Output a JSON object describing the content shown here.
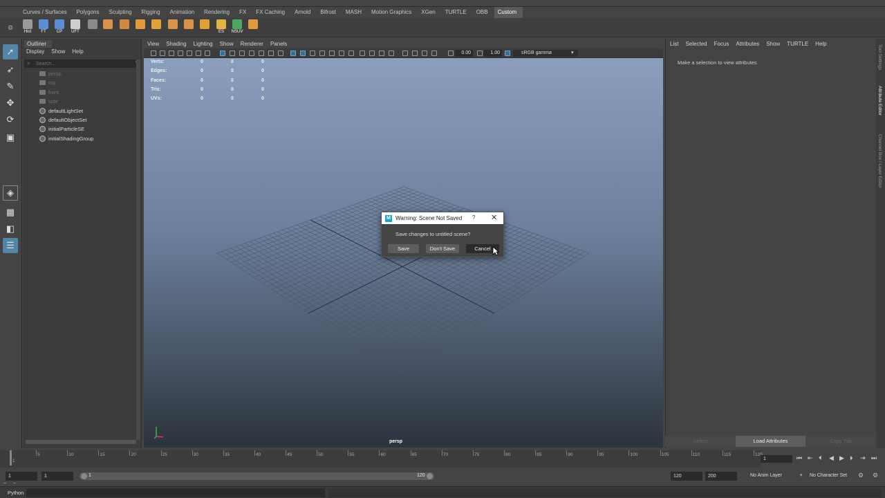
{
  "shelf_tabs": [
    "Curves / Surfaces",
    "Polygons",
    "Sculpting",
    "Rigging",
    "Animation",
    "Rendering",
    "FX",
    "FX Caching",
    "Arnold",
    "Bifrost",
    "MASH",
    "Motion Graphics",
    "XGen",
    "TURTLE",
    "OBB",
    "Custom"
  ],
  "shelf_active_tab": "Custom",
  "shelf_buttons": [
    {
      "label": "Hist",
      "icon": "history-icon",
      "color": "#9a9a9a"
    },
    {
      "label": "FT",
      "icon": "freeze-transform-icon",
      "color": "#5b8ed6"
    },
    {
      "label": "CP",
      "icon": "center-pivot-icon",
      "color": "#5b8ed6"
    },
    {
      "label": "UFT",
      "icon": "unfreeze-transform-icon",
      "color": "#cfcfcf"
    },
    {
      "label": "",
      "icon": "snap-grid-icon",
      "color": "#8a8a8a"
    },
    {
      "label": "",
      "icon": "cube-icon",
      "color": "#d9924a"
    },
    {
      "label": "",
      "icon": "scatter-icon",
      "color": "#d08a40"
    },
    {
      "label": "",
      "icon": "arrow-tool-icon",
      "color": "#e39a3c"
    },
    {
      "label": "",
      "icon": "pencil-icon",
      "color": "#e3a13c"
    },
    {
      "label": "",
      "icon": "brush-icon",
      "color": "#d9924a"
    },
    {
      "label": "",
      "icon": "box-icon",
      "color": "#d9924a"
    },
    {
      "label": "",
      "icon": "diamond-icon",
      "color": "#e0a030"
    },
    {
      "label": "ES",
      "icon": "folder-icon",
      "color": "#e0b440"
    },
    {
      "label": "NSUV",
      "icon": "uv-icon",
      "color": "#4ea860"
    },
    {
      "label": "",
      "icon": "sphere-cube-icon",
      "color": "#e09a40"
    }
  ],
  "outliner": {
    "tab_label": "Outliner",
    "menu": [
      "Display",
      "Show",
      "Help"
    ],
    "search_placeholder": "Search...",
    "items": [
      {
        "label": "persp",
        "dim": true,
        "icon": "camera-icon"
      },
      {
        "label": "top",
        "dim": true,
        "icon": "camera-icon"
      },
      {
        "label": "front",
        "dim": true,
        "icon": "camera-icon"
      },
      {
        "label": "side",
        "dim": true,
        "icon": "camera-icon"
      },
      {
        "label": "defaultLightSet",
        "dim": false,
        "icon": "set-icon"
      },
      {
        "label": "defaultObjectSet",
        "dim": false,
        "icon": "set-icon"
      },
      {
        "label": "initialParticleSE",
        "dim": false,
        "icon": "set-icon"
      },
      {
        "label": "initialShadingGroup",
        "dim": false,
        "icon": "set-icon"
      }
    ]
  },
  "viewport": {
    "menu": [
      "View",
      "Shading",
      "Lighting",
      "Show",
      "Renderer",
      "Panels"
    ],
    "exposure": "0.00",
    "gamma": "1.00",
    "color_space": "sRGB gamma",
    "camera_label": "persp",
    "hud": [
      {
        "label": "Verts:",
        "values": [
          "0",
          "0",
          "0"
        ]
      },
      {
        "label": "Edges:",
        "values": [
          "0",
          "0",
          "0"
        ]
      },
      {
        "label": "Faces:",
        "values": [
          "0",
          "0",
          "0"
        ]
      },
      {
        "label": "Tris:",
        "values": [
          "0",
          "0",
          "0"
        ]
      },
      {
        "label": "UVs:",
        "values": [
          "0",
          "0",
          "0"
        ]
      }
    ]
  },
  "dialog": {
    "title": "Warning: Scene Not Saved",
    "help": "?",
    "close": "✕",
    "message": "Save changes to untitled scene?",
    "buttons": {
      "save": "Save",
      "dont_save": "Don't Save",
      "cancel": "Cancel"
    }
  },
  "attribute_editor": {
    "menu": [
      "List",
      "Selected",
      "Focus",
      "Attributes",
      "Show",
      "TURTLE",
      "Help"
    ],
    "message": "Make a selection to view attributes",
    "buttons": {
      "select": "Select",
      "load": "Load Attributes",
      "copy": "Copy Tab"
    },
    "side_tabs": [
      "Tool Settings",
      "Attribute Editor",
      "Channel Box / Layer Editor"
    ]
  },
  "timeline": {
    "ticks": [
      "1",
      "5",
      "10",
      "15",
      "20",
      "25",
      "30",
      "35",
      "40",
      "45",
      "50",
      "55",
      "60",
      "65",
      "70",
      "75",
      "80",
      "85",
      "90",
      "95",
      "100",
      "105",
      "110",
      "115",
      "120"
    ],
    "current_frame": "1"
  },
  "range": {
    "start": "1",
    "playback_start": "1",
    "range_start_label": "1",
    "range_end_label": "120",
    "playback_end": "120",
    "end": "200",
    "anim_layer": "No Anim Layer",
    "character_set": "No Character Set"
  },
  "command_line": {
    "language": "Python"
  }
}
